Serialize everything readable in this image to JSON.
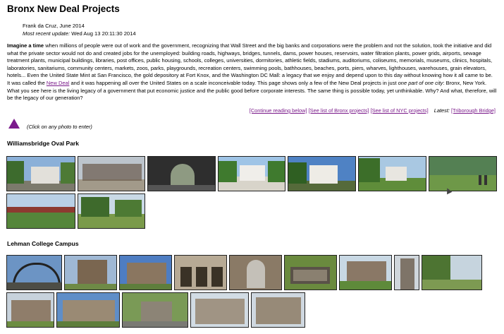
{
  "page": {
    "title": "Bronx New Deal Projects",
    "author": "Frank da Cruz, June 2014",
    "update_label": "Most recent update:",
    "update_value": "Wed Aug 13 20:11:30 2014"
  },
  "intro": {
    "lead": "Imagine a time",
    "text_1": " when millions of people were out of work and the government, recognizing that Wall Street and the big banks and corporations were the problem and not the solution, took the initiative and did what the private sector would not do and created jobs for the unemployed: building roads, highways, bridges, tunnels, dams, power houses, reservoirs, water filtration plants, power grids, airports, sewage treatment plants, municipal buildings, libraries, post offices, public housing, schools, colleges, universities, dormitories, athletic fields, stadiums, auditoriums, coliseums, memorials, museums, clinics, hospitals, laboratories, sanitariums, community centers, markets, zoos, parks, playgrounds, recreation centers, swimming pools, bathhouses, beaches, ports, piers, wharves, lighthouses, warehouses, grain elevators, hotels... Even the United State Mint at San Francisco, the gold depository at Fort Knox, and the Washington DC Mall: a legacy that we enjoy and depend upon to this day without knowing how it all came to be. It was called the ",
    "link": "New Deal",
    "text_2": " and it was happening all over the United States on a scale inconceivable today. This page shows only a few of the New Deal projects in just ",
    "em_1": "one part of one city",
    "text_3": ": Bronx, New York. What you see here is the living legacy of a government that put economic justice and the public good before corporate interests. The same thing is possible today, yet unthinkable. Why? And what, therefore, will be the legacy of our generation?"
  },
  "links": {
    "continue": "[Continue reading below]",
    "bronx": "[See list of Bronx projects]",
    "nyc": "[See list of NYC projects]",
    "latest_label": "Latest:",
    "latest": "[Triborough Bridge]"
  },
  "hint": "(Click on any photo to enter)",
  "sections": {
    "s1": "Williamsbridge Oval Park",
    "s2": "Lehman College Campus"
  },
  "colors": {
    "link": "#7a1a8a",
    "triangle": "#7b1a8c"
  }
}
